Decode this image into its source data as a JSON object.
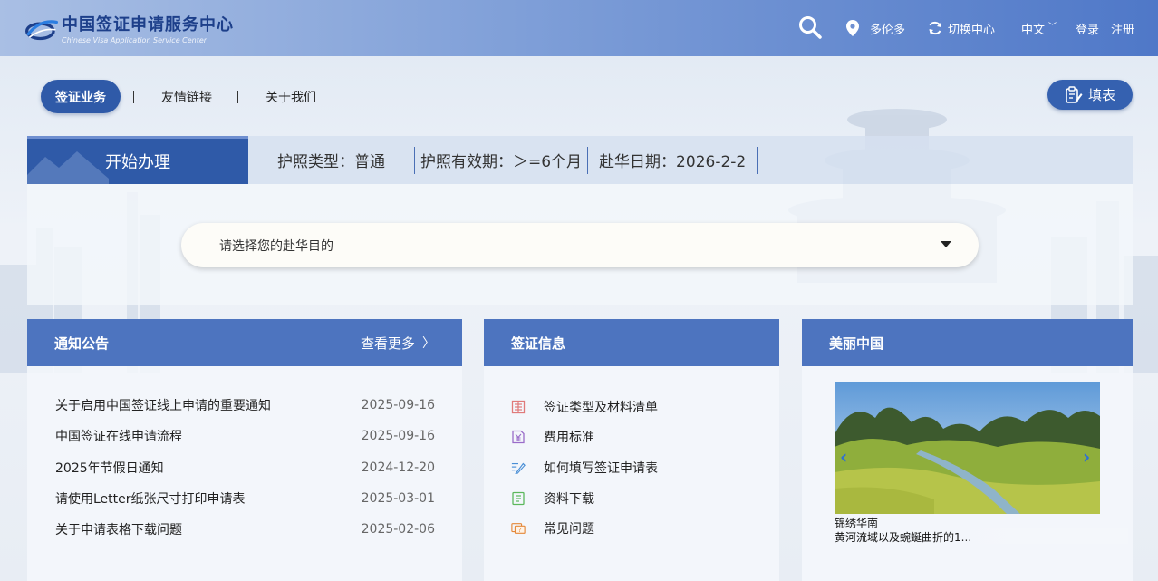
{
  "header": {
    "logo_cn": "中国签证申请服务中心",
    "logo_en": "Chinese Visa Application Service Center",
    "location": "多伦多",
    "switch_center": "切换中心",
    "language": "中文",
    "login": "登录",
    "register": "注册"
  },
  "nav": {
    "visa_service": "签证业务",
    "friendly_links": "友情链接",
    "about_us": "关于我们",
    "fill_form": "填表"
  },
  "start": {
    "tab": "开始办理",
    "passport_type": "护照类型：普通",
    "passport_validity": "护照有效期：＞=6个月",
    "arrival_date": "赴华日期：2026-2-2",
    "purpose_placeholder": "请选择您的赴华目的"
  },
  "notice": {
    "title": "通知公告",
    "more": "查看更多",
    "items": [
      {
        "title": "关于启用中国签证线上申请的重要通知",
        "date": "2025-09-16"
      },
      {
        "title": "中国签证在线申请流程",
        "date": "2025-09-16"
      },
      {
        "title": "2025年节假日通知",
        "date": "2024-12-20"
      },
      {
        "title": "请使用Letter纸张尺寸打印申请表",
        "date": "2025-03-01"
      },
      {
        "title": "关于申请表格下载问题",
        "date": "2025-02-06"
      }
    ]
  },
  "visa_info": {
    "title": "签证信息",
    "items": [
      {
        "label": "签证类型及材料清单",
        "icon": "checklist-icon",
        "color": "#e07a7a"
      },
      {
        "label": "费用标准",
        "icon": "yuan-doc-icon",
        "color": "#9a6cc9"
      },
      {
        "label": "如何填写签证申请表",
        "icon": "pen-icon",
        "color": "#4a8fd6"
      },
      {
        "label": "资料下载",
        "icon": "document-icon",
        "color": "#5cb85c"
      },
      {
        "label": "常见问题",
        "icon": "question-icon",
        "color": "#e5893a"
      }
    ]
  },
  "china": {
    "title": "美丽中国",
    "caption_title": "锦绣华南",
    "caption_desc": "黄河流域以及蜿蜒曲折的1..."
  },
  "colors": {
    "primary": "#2f5aa8",
    "card_header": "#4d74bf",
    "topbar_end": "#4f78c8"
  }
}
